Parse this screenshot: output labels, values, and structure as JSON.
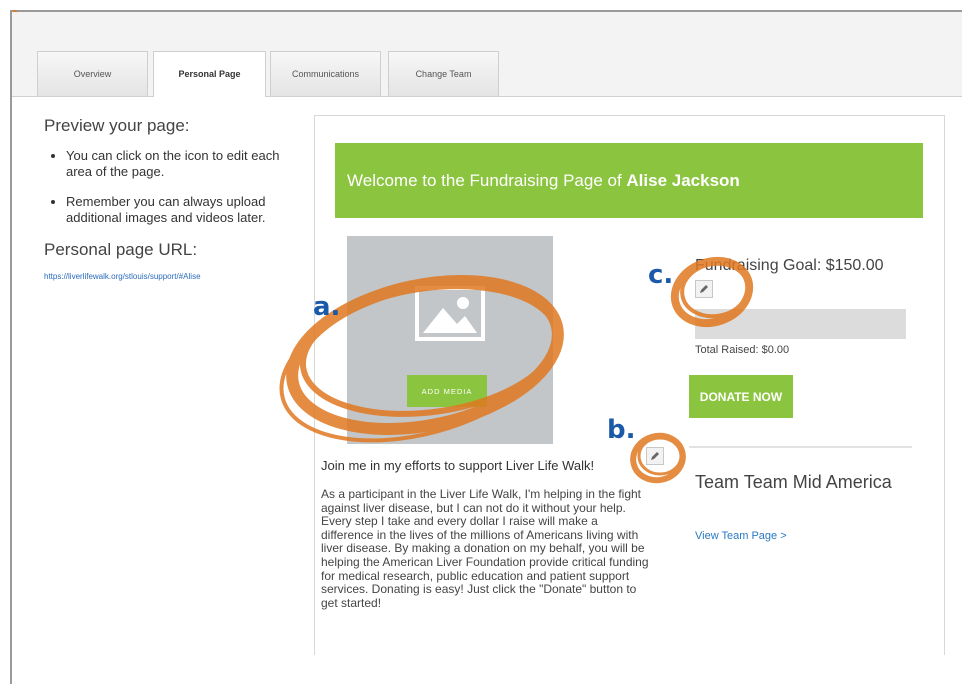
{
  "tabs": [
    {
      "label": "Overview"
    },
    {
      "label": "Personal Page"
    },
    {
      "label": "Communications"
    },
    {
      "label": "Change Team"
    }
  ],
  "left": {
    "preview_heading": "Preview your page:",
    "bullets": [
      "You can click on the icon to edit each area of the page.",
      "Remember you can always upload additional images and videos later."
    ],
    "url_heading": "Personal page URL:",
    "url": "https://liverlifewalk.org/stlouis/support/#Alise"
  },
  "banner": {
    "prefix": "Welcome to the Fundraising Page of ",
    "name": "Alise Jackson"
  },
  "media": {
    "button_label": "ADD MEDIA",
    "icon": "image-icon"
  },
  "story": {
    "title": "Join me in my efforts to support Liver Life Walk!",
    "body": "As a participant in the Liver Life Walk, I'm helping in the fight against liver disease, but I can not do it without your help. Every step I take and every dollar I raise will make a difference in the lives of the millions of Americans living with liver disease. By making a donation on my behalf, you will be helping the American Liver Foundation provide critical funding for medical research, public education and patient support services. Donating is easy! Just click the \"Donate\" button to get started!"
  },
  "goal": {
    "title": "Fundraising Goal: $150.00",
    "raised": "Total Raised: $0.00",
    "progress_fraction": 0,
    "donate_label": "DONATE NOW"
  },
  "team": {
    "name": "Team Team Mid America",
    "link": "View Team Page >"
  },
  "callouts": {
    "a": "a.",
    "b": "b.",
    "c": "c."
  },
  "colors": {
    "accent_green": "#8bc43f",
    "callout_blue": "#1a5aa8",
    "annotation_orange": "#e07820",
    "link_blue": "#2a7ac4"
  }
}
